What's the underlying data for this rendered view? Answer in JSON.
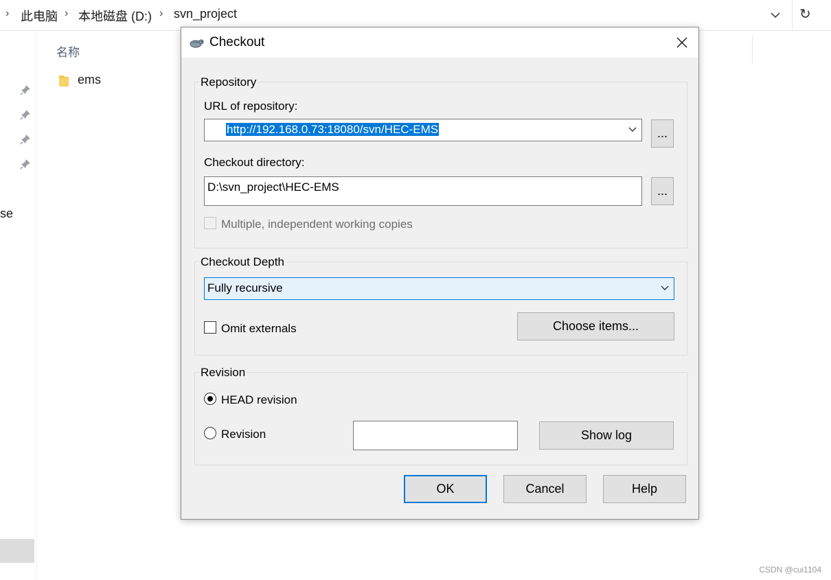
{
  "explorer": {
    "breadcrumbs": [
      "此电脑",
      "本地磁盘 (D:)",
      "svn_project"
    ],
    "column_header": "名称",
    "files": [
      {
        "name": "ems",
        "icon": "folder-icon"
      }
    ],
    "nav_partial_text": "se",
    "watermark": "CSDN @cui1104"
  },
  "dialog": {
    "title": "Checkout",
    "repository": {
      "group_label": "Repository",
      "url_label": "URL of repository:",
      "url_value": "http://192.168.0.73:18080/svn/HEC-EMS",
      "browse_label": "...",
      "dir_label": "Checkout directory:",
      "dir_value": "D:\\svn_project\\HEC-EMS",
      "dir_browse_label": "...",
      "multiple_label": "Multiple, independent working copies",
      "multiple_checked": false
    },
    "depth": {
      "group_label": "Checkout Depth",
      "selected": "Fully recursive",
      "omit_label": "Omit externals",
      "omit_checked": false,
      "choose_label": "Choose items..."
    },
    "revision": {
      "group_label": "Revision",
      "head_label": "HEAD revision",
      "head_selected": true,
      "rev_label": "Revision",
      "rev_value": "",
      "show_log_label": "Show log"
    },
    "buttons": {
      "ok": "OK",
      "cancel": "Cancel",
      "help": "Help"
    }
  },
  "colors": {
    "selection": "#0078d7",
    "dialog_bg": "#f0f0f0",
    "focus_bg": "#e5f1fb"
  }
}
